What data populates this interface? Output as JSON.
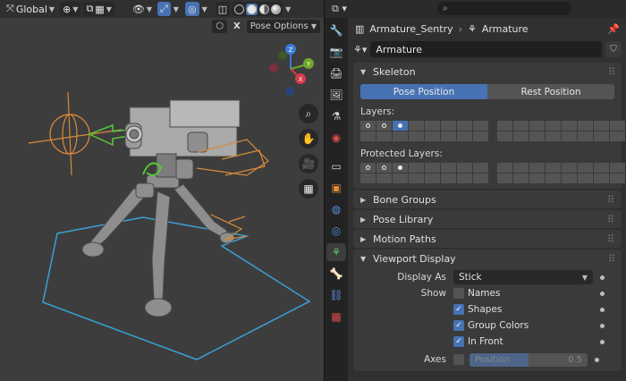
{
  "viewport": {
    "transform_orientation": "Global",
    "pose_options_label": "Pose Options",
    "x_label": "X",
    "gizmo": {
      "x": "X",
      "y": "Y",
      "z": "Z"
    }
  },
  "properties": {
    "breadcrumb": {
      "object": "Armature_Sentry",
      "data": "Armature"
    },
    "name_field": "Armature",
    "skeleton": {
      "title": "Skeleton",
      "pose_position": "Pose Position",
      "rest_position": "Rest Position",
      "selected": "Pose Position",
      "layers_label": "Layers:",
      "protected_label": "Protected Layers:"
    },
    "panels": {
      "bone_groups": "Bone Groups",
      "pose_library": "Pose Library",
      "motion_paths": "Motion Paths",
      "viewport_display": "Viewport Display"
    },
    "viewport_display": {
      "display_as_label": "Display As",
      "display_as_value": "Stick",
      "show_label": "Show",
      "names": {
        "label": "Names",
        "checked": false
      },
      "shapes": {
        "label": "Shapes",
        "checked": true
      },
      "group_colors": {
        "label": "Group Colors",
        "checked": true
      },
      "in_front": {
        "label": "In Front",
        "checked": true
      },
      "axes_label": "Axes",
      "axes_checked": false,
      "position_label": "Position",
      "position_value": "0.5"
    }
  },
  "colors": {
    "accent": "#4772b3",
    "gizmo_x": "#d63b4b",
    "gizmo_y": "#6ea52b",
    "gizmo_z": "#3b7cd6"
  }
}
